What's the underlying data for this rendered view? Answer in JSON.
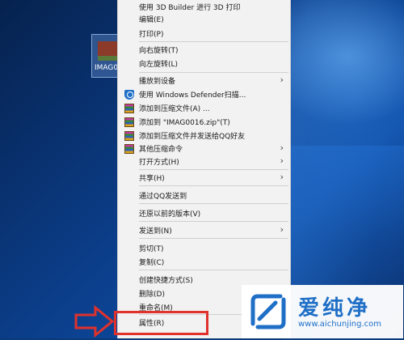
{
  "desktop": {
    "icon_label": "IMAG0"
  },
  "context_menu": {
    "items": [
      {
        "label": "使用 3D Builder 进行 3D 打印",
        "icon": "",
        "submenu": false
      },
      {
        "label": "编辑(E)",
        "icon": "",
        "submenu": false
      },
      {
        "label": "打印(P)",
        "icon": "",
        "submenu": false
      },
      {
        "label": "向右旋转(T)",
        "icon": "",
        "submenu": false
      },
      {
        "label": "向左旋转(L)",
        "icon": "",
        "submenu": false
      },
      {
        "label": "播放到设备",
        "icon": "",
        "submenu": true
      },
      {
        "label": "使用 Windows Defender扫描...",
        "icon": "windows-defender-shield-icon",
        "submenu": false
      },
      {
        "label": "添加到压缩文件(A) ...",
        "icon": "winrar-archive-icon",
        "submenu": false
      },
      {
        "label": "添加到 \"IMAG0016.zip\"(T)",
        "icon": "winrar-archive-icon",
        "submenu": false
      },
      {
        "label": "添加到压缩文件并发送给QQ好友",
        "icon": "winrar-archive-icon",
        "submenu": false
      },
      {
        "label": "其他压缩命令",
        "icon": "winrar-archive-icon",
        "submenu": true
      },
      {
        "label": "打开方式(H)",
        "icon": "",
        "submenu": true
      },
      {
        "label": "共享(H)",
        "icon": "",
        "submenu": true
      },
      {
        "label": "通过QQ发送到",
        "icon": "",
        "submenu": false
      },
      {
        "label": "还原以前的版本(V)",
        "icon": "",
        "submenu": false
      },
      {
        "label": "发送到(N)",
        "icon": "",
        "submenu": true
      },
      {
        "label": "剪切(T)",
        "icon": "",
        "submenu": false
      },
      {
        "label": "复制(C)",
        "icon": "",
        "submenu": false
      },
      {
        "label": "创建快捷方式(S)",
        "icon": "",
        "submenu": false
      },
      {
        "label": "删除(D)",
        "icon": "",
        "submenu": false
      },
      {
        "label": "重命名(M)",
        "icon": "",
        "submenu": false
      },
      {
        "label": "属性(R)",
        "icon": "",
        "submenu": false
      }
    ],
    "submenu_arrow": "›",
    "highlighted_item": "属性(R)",
    "highlight_color": "#e0312c"
  },
  "watermark": {
    "title": "爱纯净",
    "url": "www.aichunjing.com",
    "brand_color": "#1f6fc7"
  }
}
